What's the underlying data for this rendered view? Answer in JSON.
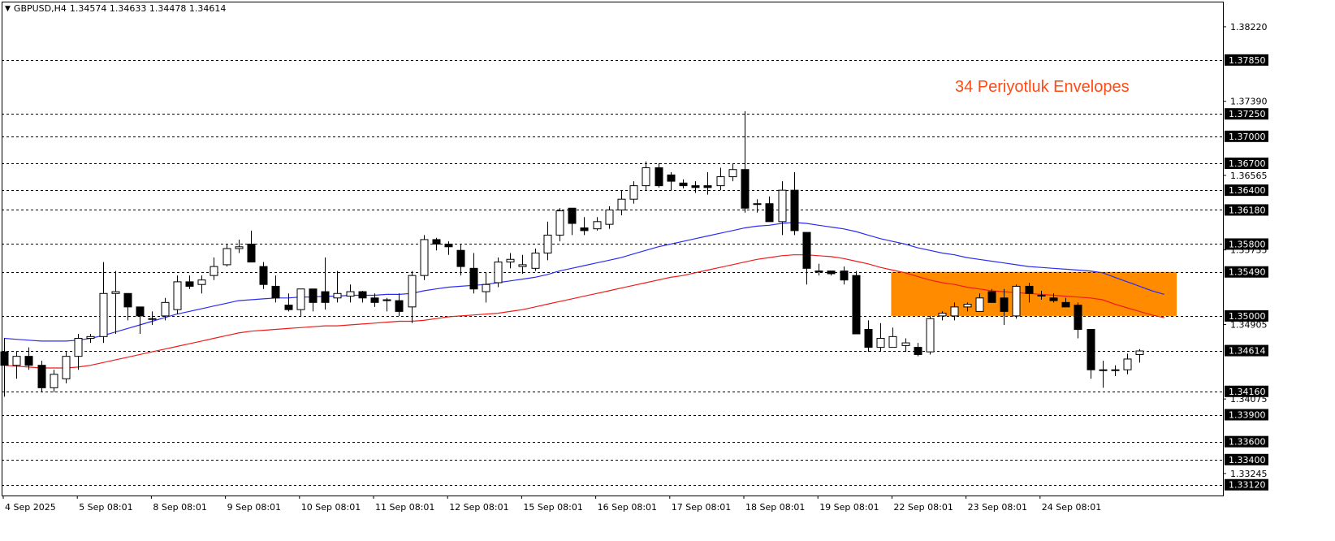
{
  "header": {
    "symbol_tf": "GBPUSD,H4",
    "ohlc": "1.34574 1.34633 1.34478 1.34614"
  },
  "annotation": "34 Periyotluk Envelopes",
  "colors": {
    "upper_band": "#2c2cf0",
    "lower_band": "#ee1c1c",
    "zone": "#ff8c00",
    "annotation": "#ff4a14",
    "level_label_bg": "#000000"
  },
  "chart_data": {
    "type": "candlestick",
    "symbol": "GBPUSD",
    "timeframe": "H4",
    "ylim": [
      1.33,
      1.385
    ],
    "price_ticks": [
      "1.38220",
      "1.37390",
      "1.36565",
      "1.35735",
      "1.34905",
      "1.34075",
      "1.33245"
    ],
    "time_labels": [
      {
        "label": "4 Sep 2025",
        "bar": 0
      },
      {
        "label": "5 Sep 08:01",
        "bar": 6
      },
      {
        "label": "8 Sep 08:01",
        "bar": 12
      },
      {
        "label": "9 Sep 08:01",
        "bar": 18
      },
      {
        "label": "10 Sep 08:01",
        "bar": 24
      },
      {
        "label": "11 Sep 08:01",
        "bar": 30
      },
      {
        "label": "12 Sep 08:01",
        "bar": 36
      },
      {
        "label": "15 Sep 08:01",
        "bar": 42
      },
      {
        "label": "16 Sep 08:01",
        "bar": 48
      },
      {
        "label": "17 Sep 08:01",
        "bar": 54
      },
      {
        "label": "18 Sep 08:01",
        "bar": 60
      },
      {
        "label": "19 Sep 08:01",
        "bar": 66
      },
      {
        "label": "22 Sep 08:01",
        "bar": 72
      },
      {
        "label": "23 Sep 08:01",
        "bar": 78
      },
      {
        "label": "24 Sep 08:01",
        "bar": 84
      }
    ],
    "levels": [
      {
        "price": 1.3785,
        "label": "1.37850"
      },
      {
        "price": 1.3725,
        "label": "1.37250"
      },
      {
        "price": 1.37,
        "label": "1.37000"
      },
      {
        "price": 1.367,
        "label": "1.36700"
      },
      {
        "price": 1.364,
        "label": "1.36400"
      },
      {
        "price": 1.3618,
        "label": "1.36180"
      },
      {
        "price": 1.358,
        "label": "1.35800"
      },
      {
        "price": 1.3549,
        "label": "1.35490"
      },
      {
        "price": 1.35,
        "label": "1.35000"
      },
      {
        "price": 1.34614,
        "label": "1.34614"
      },
      {
        "price": 1.3416,
        "label": "1.34160"
      },
      {
        "price": 1.339,
        "label": "1.33900"
      },
      {
        "price": 1.336,
        "label": "1.33600"
      },
      {
        "price": 1.334,
        "label": "1.33400"
      },
      {
        "price": 1.3312,
        "label": "1.33120"
      }
    ],
    "zone": {
      "bar_start": 72,
      "bar_end": 95,
      "top": 1.3549,
      "bottom": 1.35
    },
    "candles": [
      [
        1.346,
        1.3475,
        1.341,
        1.3445
      ],
      [
        1.3445,
        1.346,
        1.343,
        1.3455
      ],
      [
        1.3455,
        1.3465,
        1.344,
        1.3445
      ],
      [
        1.3445,
        1.345,
        1.3415,
        1.342
      ],
      [
        1.342,
        1.344,
        1.3415,
        1.3435
      ],
      [
        1.343,
        1.346,
        1.3425,
        1.3455
      ],
      [
        1.3455,
        1.348,
        1.344,
        1.3475
      ],
      [
        1.3475,
        1.348,
        1.347,
        1.3477
      ],
      [
        1.3477,
        1.356,
        1.347,
        1.3525
      ],
      [
        1.3525,
        1.355,
        1.348,
        1.3527
      ],
      [
        1.3525,
        1.3525,
        1.3495,
        1.351
      ],
      [
        1.351,
        1.351,
        1.348,
        1.35
      ],
      [
        1.3497,
        1.3505,
        1.349,
        1.3497
      ],
      [
        1.35,
        1.352,
        1.3495,
        1.3515
      ],
      [
        1.3507,
        1.3545,
        1.3502,
        1.3538
      ],
      [
        1.3538,
        1.3545,
        1.353,
        1.3533
      ],
      [
        1.3535,
        1.3545,
        1.3525,
        1.354
      ],
      [
        1.3545,
        1.3565,
        1.354,
        1.3555
      ],
      [
        1.3557,
        1.358,
        1.3555,
        1.3575
      ],
      [
        1.3575,
        1.3585,
        1.357,
        1.3577
      ],
      [
        1.358,
        1.3595,
        1.356,
        1.356
      ],
      [
        1.3555,
        1.356,
        1.353,
        1.3535
      ],
      [
        1.3533,
        1.3545,
        1.3515,
        1.352
      ],
      [
        1.3512,
        1.3525,
        1.3505,
        1.3507
      ],
      [
        1.3507,
        1.3527,
        1.35,
        1.353
      ],
      [
        1.353,
        1.353,
        1.3505,
        1.3515
      ],
      [
        1.3527,
        1.3565,
        1.3507,
        1.3515
      ],
      [
        1.352,
        1.355,
        1.3515,
        1.3525
      ],
      [
        1.3522,
        1.3535,
        1.3515,
        1.3527
      ],
      [
        1.3527,
        1.3528,
        1.3515,
        1.352
      ],
      [
        1.352,
        1.3525,
        1.351,
        1.3515
      ],
      [
        1.3518,
        1.352,
        1.3505,
        1.3517
      ],
      [
        1.3517,
        1.3525,
        1.35,
        1.3505
      ],
      [
        1.351,
        1.355,
        1.3492,
        1.3545
      ],
      [
        1.3545,
        1.359,
        1.354,
        1.3585
      ],
      [
        1.3585,
        1.3587,
        1.3573,
        1.358
      ],
      [
        1.358,
        1.3583,
        1.3568,
        1.3577
      ],
      [
        1.3573,
        1.358,
        1.3545,
        1.3555
      ],
      [
        1.3553,
        1.357,
        1.3525,
        1.353
      ],
      [
        1.3527,
        1.3548,
        1.3515,
        1.3535
      ],
      [
        1.3537,
        1.3565,
        1.3532,
        1.356
      ],
      [
        1.356,
        1.357,
        1.3553,
        1.3563
      ],
      [
        1.3555,
        1.3568,
        1.3547,
        1.3557
      ],
      [
        1.3553,
        1.3575,
        1.355,
        1.357
      ],
      [
        1.357,
        1.3605,
        1.3562,
        1.359
      ],
      [
        1.359,
        1.362,
        1.3583,
        1.3617
      ],
      [
        1.362,
        1.362,
        1.359,
        1.3603
      ],
      [
        1.3598,
        1.361,
        1.359,
        1.3595
      ],
      [
        1.3597,
        1.361,
        1.3595,
        1.3605
      ],
      [
        1.3602,
        1.3622,
        1.3597,
        1.3618
      ],
      [
        1.3618,
        1.364,
        1.3612,
        1.363
      ],
      [
        1.363,
        1.365,
        1.3625,
        1.3645
      ],
      [
        1.3645,
        1.3672,
        1.364,
        1.3665
      ],
      [
        1.3665,
        1.367,
        1.3643,
        1.3645
      ],
      [
        1.3657,
        1.366,
        1.364,
        1.365
      ],
      [
        1.3648,
        1.3652,
        1.3642,
        1.3645
      ],
      [
        1.3645,
        1.365,
        1.3637,
        1.3643
      ],
      [
        1.3645,
        1.366,
        1.3635,
        1.3643
      ],
      [
        1.3645,
        1.3665,
        1.364,
        1.3655
      ],
      [
        1.3655,
        1.367,
        1.365,
        1.3663
      ],
      [
        1.3663,
        1.3728,
        1.3615,
        1.362
      ],
      [
        1.3625,
        1.363,
        1.3615,
        1.3625
      ],
      [
        1.3625,
        1.3633,
        1.3605,
        1.3605
      ],
      [
        1.3605,
        1.365,
        1.359,
        1.364
      ],
      [
        1.364,
        1.366,
        1.359,
        1.3595
      ],
      [
        1.3593,
        1.3593,
        1.3535,
        1.3553
      ],
      [
        1.355,
        1.3558,
        1.3545,
        1.355
      ],
      [
        1.355,
        1.355,
        1.3545,
        1.3547
      ],
      [
        1.355,
        1.3555,
        1.3535,
        1.354
      ],
      [
        1.3545,
        1.355,
        1.348,
        1.348
      ],
      [
        1.3485,
        1.3495,
        1.346,
        1.3465
      ],
      [
        1.3465,
        1.3492,
        1.346,
        1.3475
      ],
      [
        1.3465,
        1.3487,
        1.3465,
        1.3477
      ],
      [
        1.3467,
        1.3475,
        1.346,
        1.347
      ],
      [
        1.3465,
        1.347,
        1.3455,
        1.3457
      ],
      [
        1.346,
        1.35,
        1.3457,
        1.3497
      ],
      [
        1.35,
        1.3505,
        1.3495,
        1.3503
      ],
      [
        1.35,
        1.3515,
        1.3495,
        1.351
      ],
      [
        1.351,
        1.3515,
        1.3505,
        1.3513
      ],
      [
        1.3505,
        1.3525,
        1.3505,
        1.352
      ],
      [
        1.3527,
        1.353,
        1.3515,
        1.3515
      ],
      [
        1.352,
        1.353,
        1.349,
        1.3505
      ],
      [
        1.35,
        1.3535,
        1.3497,
        1.3533
      ],
      [
        1.3533,
        1.3537,
        1.3515,
        1.3525
      ],
      [
        1.3523,
        1.3528,
        1.3518,
        1.3523
      ],
      [
        1.352,
        1.3525,
        1.3515,
        1.3517
      ],
      [
        1.3515,
        1.352,
        1.351,
        1.351
      ],
      [
        1.3512,
        1.3515,
        1.3475,
        1.3485
      ],
      [
        1.3485,
        1.3485,
        1.343,
        1.344
      ],
      [
        1.344,
        1.345,
        1.342,
        1.344
      ],
      [
        1.344,
        1.3445,
        1.3433,
        1.344
      ],
      [
        1.344,
        1.3458,
        1.3435,
        1.3452
      ],
      [
        1.3457,
        1.3463,
        1.3448,
        1.3461
      ]
    ],
    "series": [
      {
        "values": [
          1.3475,
          1.3474,
          1.3473,
          1.3472,
          1.3472,
          1.3472,
          1.3473,
          1.3475,
          1.3478,
          1.3482,
          1.3486,
          1.349,
          1.3494,
          1.3498,
          1.3502,
          1.3505,
          1.3508,
          1.3511,
          1.3514,
          1.3517,
          1.3518,
          1.3519,
          1.352,
          1.352,
          1.3521,
          1.3521,
          1.3522,
          1.3522,
          1.3523,
          1.3523,
          1.3523,
          1.3524,
          1.3524,
          1.3525,
          1.3528,
          1.353,
          1.3532,
          1.3533,
          1.3534,
          1.3535,
          1.3537,
          1.3539,
          1.3541,
          1.3543,
          1.3546,
          1.355,
          1.3553,
          1.3556,
          1.3559,
          1.3562,
          1.3565,
          1.3569,
          1.3573,
          1.3577,
          1.358,
          1.3583,
          1.3586,
          1.3589,
          1.3592,
          1.3595,
          1.3598,
          1.36,
          1.3601,
          1.3603,
          1.3604,
          1.3603,
          1.3601,
          1.3599,
          1.3597,
          1.3594,
          1.359,
          1.3586,
          1.3583,
          1.358,
          1.3576,
          1.3573,
          1.357,
          1.3568,
          1.3565,
          1.3563,
          1.3561,
          1.3559,
          1.3557,
          1.3555,
          1.3554,
          1.3553,
          1.3552,
          1.3551,
          1.355,
          1.3548,
          1.3543,
          1.3538,
          1.3533,
          1.3528,
          1.3524
        ]
      },
      {
        "values": [
          1.3445,
          1.3444,
          1.3443,
          1.3442,
          1.3442,
          1.3442,
          1.3443,
          1.3445,
          1.3448,
          1.3451,
          1.3454,
          1.3457,
          1.346,
          1.3463,
          1.3466,
          1.3469,
          1.3472,
          1.3475,
          1.3478,
          1.3481,
          1.3483,
          1.3484,
          1.3485,
          1.3486,
          1.3487,
          1.3488,
          1.3489,
          1.3489,
          1.349,
          1.3491,
          1.3492,
          1.3493,
          1.3494,
          1.3494,
          1.3495,
          1.3497,
          1.3499,
          1.35,
          1.3501,
          1.3502,
          1.3503,
          1.3505,
          1.3507,
          1.351,
          1.3513,
          1.3516,
          1.3519,
          1.3522,
          1.3525,
          1.3528,
          1.3531,
          1.3534,
          1.3537,
          1.354,
          1.3543,
          1.3545,
          1.3548,
          1.3551,
          1.3554,
          1.3557,
          1.356,
          1.3563,
          1.3565,
          1.3567,
          1.3568,
          1.3568,
          1.3567,
          1.3566,
          1.3564,
          1.3561,
          1.3558,
          1.3554,
          1.3551,
          1.3548,
          1.3544,
          1.354,
          1.3537,
          1.3535,
          1.3532,
          1.353,
          1.3528,
          1.3527,
          1.3526,
          1.3525,
          1.3524,
          1.3523,
          1.3522,
          1.3521,
          1.352,
          1.3518,
          1.3513,
          1.3509,
          1.3505,
          1.3501,
          1.3498
        ]
      }
    ]
  }
}
